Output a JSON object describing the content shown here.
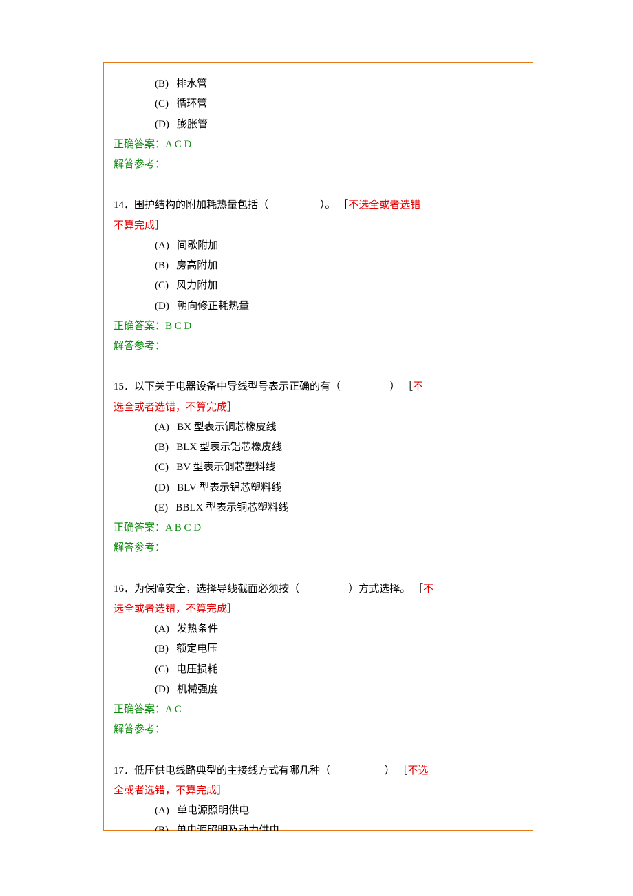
{
  "q13_prev": {
    "optB": "(B)   排水管",
    "optC": "(C)   循环管",
    "optD": "(D)   膨胀管",
    "answer_label": "正确答案：",
    "answer_value": "A C D",
    "ref_label": "解答参考："
  },
  "q14": {
    "num": "14．",
    "stem": "围护结构的附加耗热量包括（                    ）。 ［",
    "note1": "不选全或者选错",
    "note2": "不算完成",
    "close": "］",
    "optA": "(A)   间歇附加",
    "optB": "(B)   房高附加",
    "optC": "(C)   风力附加",
    "optD": "(D)   朝向修正耗热量",
    "answer_label": "正确答案：",
    "answer_value": "B C D",
    "ref_label": "解答参考："
  },
  "q15": {
    "num": "15．",
    "stem": "以下关于电器设备中导线型号表示正确的有（                   ） ［",
    "note1a": "不",
    "note1b": "选全或者选错，不算完成",
    "close": "］",
    "optA": "(A)   BX 型表示铜芯橡皮线",
    "optB": "(B)   BLX 型表示铝芯橡皮线",
    "optC": "(C)   BV 型表示铜芯塑料线",
    "optD": "(D)   BLV 型表示铝芯塑料线",
    "optE": "(E)   BBLX 型表示铜芯塑料线",
    "answer_label": "正确答案：",
    "answer_value": "A B C D",
    "ref_label": "解答参考："
  },
  "q16": {
    "num": "16．",
    "stem": "为保障安全，选择导线截面必须按（                   ）方式选择。 ［",
    "note1a": "不",
    "note1b": "选全或者选错，不算完成",
    "close": "］",
    "optA": "(A)   发热条件",
    "optB": "(B)   额定电压",
    "optC": "(C)   电压损耗",
    "optD": "(D)   机械强度",
    "answer_label": "正确答案：",
    "answer_value": "A C",
    "ref_label": "解答参考："
  },
  "q17": {
    "num": "17．",
    "stem": "低压供电线路典型的主接线方式有哪几种（                     ） ［",
    "note1a": "不选",
    "note1b": "全或者选错，不算完成",
    "close": "］",
    "optA": "(A)   单电源照明供电",
    "optB": "(B)   单电源照明及动力供电"
  }
}
